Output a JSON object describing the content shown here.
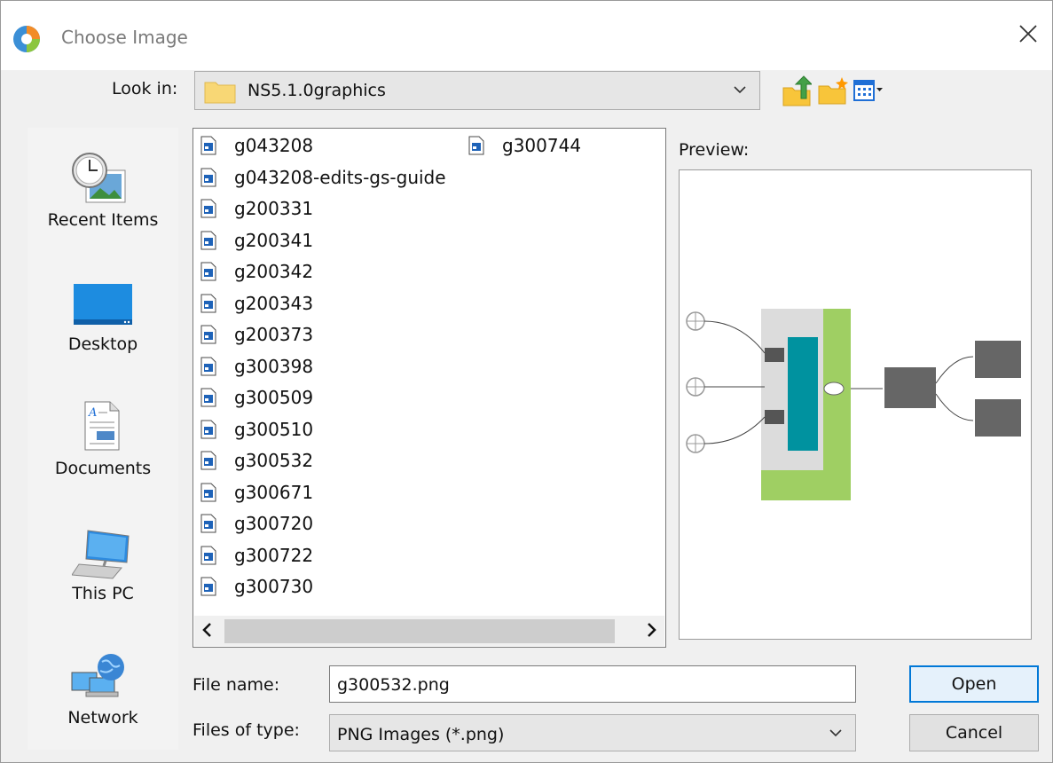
{
  "window": {
    "title": "Choose Image",
    "icons": {
      "app": "app-logo-icon",
      "close": "close-icon"
    }
  },
  "look_in": {
    "label": "Look in:",
    "value": "NS5.1.0graphics",
    "toolbar_icons": [
      "up-folder-icon",
      "new-folder-icon",
      "view-menu-icon"
    ]
  },
  "places": [
    {
      "label": "Recent Items",
      "icon": "recent-items-icon"
    },
    {
      "label": "Desktop",
      "icon": "desktop-icon"
    },
    {
      "label": "Documents",
      "icon": "documents-icon"
    },
    {
      "label": "This PC",
      "icon": "computer-icon"
    },
    {
      "label": "Network",
      "icon": "network-icon"
    }
  ],
  "files": [
    "g043208",
    "g043208-edits-gs-guide",
    "g200331",
    "g200341",
    "g200342",
    "g200343",
    "g200373",
    "g300398",
    "g300509",
    "g300510",
    "g300532",
    "g300671",
    "g300720",
    "g300722",
    "g300730",
    "g300744"
  ],
  "preview": {
    "label": "Preview:"
  },
  "file_name": {
    "label": "File name:",
    "value": "g300532.png"
  },
  "file_type": {
    "label": "Files of type:",
    "value": "PNG Images (*.png)"
  },
  "buttons": {
    "open": "Open",
    "cancel": "Cancel"
  },
  "colors": {
    "accent": "#0078d7",
    "teal": "#00929f",
    "green": "#9fcf63",
    "folder": "#f8d775"
  }
}
